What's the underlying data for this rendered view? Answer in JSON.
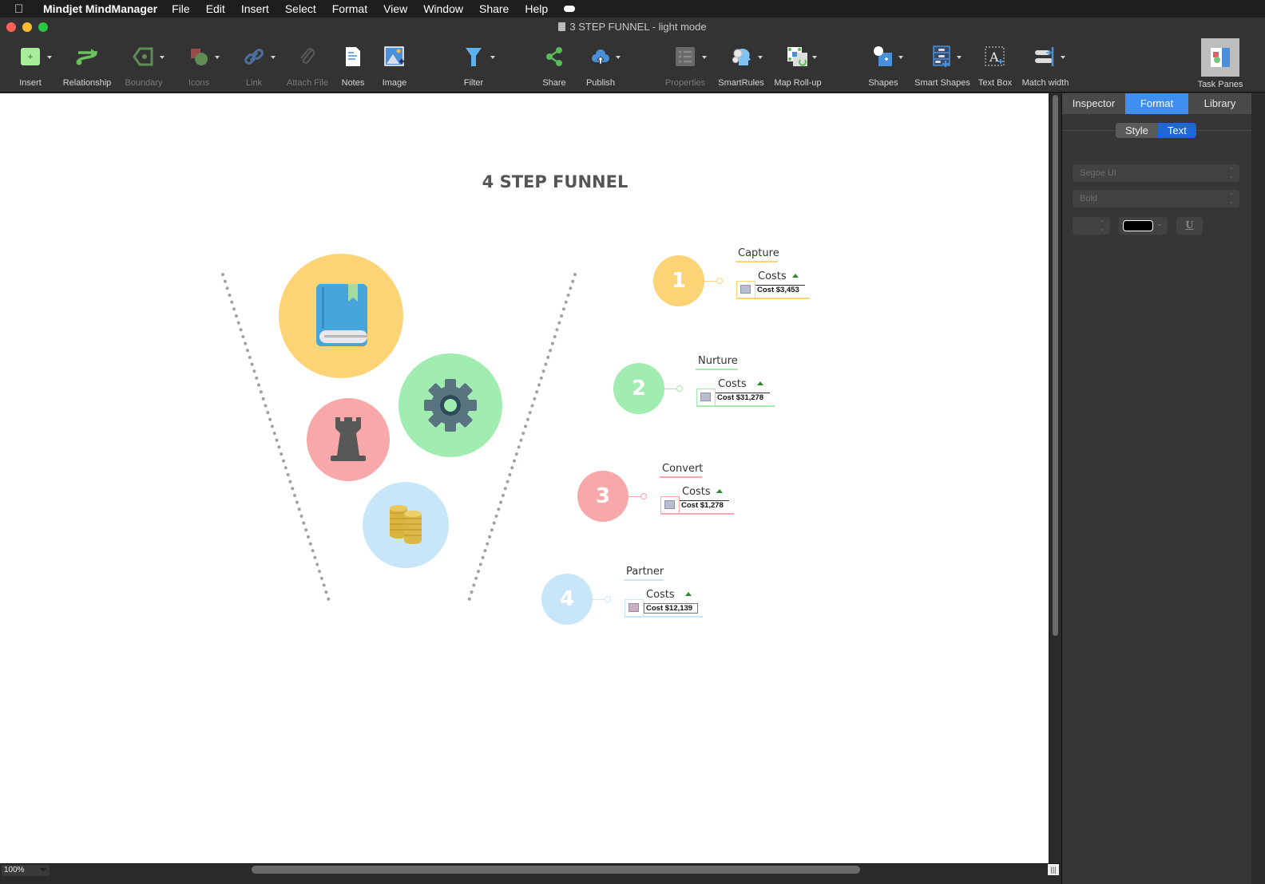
{
  "menubar": {
    "app_name": "Mindjet MindManager",
    "items": [
      "File",
      "Edit",
      "Insert",
      "Select",
      "Format",
      "View",
      "Window",
      "Share",
      "Help"
    ]
  },
  "window": {
    "title": "3 STEP FUNNEL - light mode"
  },
  "toolbar": {
    "items": [
      {
        "label": "Insert",
        "icon": "insert-topic-icon",
        "enabled": true
      },
      {
        "label": "Relationship",
        "icon": "relationship-icon",
        "enabled": true
      },
      {
        "label": "Boundary",
        "icon": "boundary-icon",
        "enabled": false
      },
      {
        "label": "Icons",
        "icon": "icons-icon",
        "enabled": false
      },
      {
        "label": "Link",
        "icon": "link-icon",
        "enabled": false
      },
      {
        "label": "Attach File",
        "icon": "paperclip-icon",
        "enabled": false
      },
      {
        "label": "Notes",
        "icon": "notes-icon",
        "enabled": true
      },
      {
        "label": "Image",
        "icon": "image-icon",
        "enabled": true
      },
      {
        "label": "Filter",
        "icon": "filter-icon",
        "enabled": true
      },
      {
        "label": "Share",
        "icon": "share-icon",
        "enabled": true
      },
      {
        "label": "Publish",
        "icon": "cloud-upload-icon",
        "enabled": true
      },
      {
        "label": "Properties",
        "icon": "properties-icon",
        "enabled": false
      },
      {
        "label": "SmartRules",
        "icon": "smartrules-icon",
        "enabled": true
      },
      {
        "label": "Map Roll-up",
        "icon": "map-rollup-icon",
        "enabled": true
      },
      {
        "label": "Shapes",
        "icon": "shapes-icon",
        "enabled": true
      },
      {
        "label": "Smart Shapes",
        "icon": "smart-shapes-icon",
        "enabled": true
      },
      {
        "label": "Text Box",
        "icon": "text-box-icon",
        "enabled": true
      },
      {
        "label": "Match width",
        "icon": "match-width-icon",
        "enabled": true
      },
      {
        "label": "Task Panes",
        "icon": "task-panes-icon",
        "enabled": true
      }
    ]
  },
  "map": {
    "title": "4 STEP FUNNEL",
    "funnel_icons": [
      "book-icon",
      "gear-icon",
      "rook-icon",
      "coins-icon"
    ],
    "steps": [
      {
        "number": "1",
        "label": "Capture",
        "costs_label": "Costs",
        "cost": "Cost $3,453",
        "color": "#fcd476"
      },
      {
        "number": "2",
        "label": "Nurture",
        "costs_label": "Costs",
        "cost": "Cost $31,278",
        "color": "#a1ecb0"
      },
      {
        "number": "3",
        "label": "Convert",
        "costs_label": "Costs",
        "cost": "Cost $1,278",
        "color": "#f8a8a8"
      },
      {
        "number": "4",
        "label": "Partner",
        "costs_label": "Costs",
        "cost": "Cost $12,139",
        "color": "#c8e6fa"
      }
    ]
  },
  "status": {
    "zoom": "100%"
  },
  "panel": {
    "tabs": [
      "Inspector",
      "Format",
      "Library"
    ],
    "active_tab": "Format",
    "subtabs": [
      "Style",
      "Text"
    ],
    "active_subtab": "Text",
    "font_family": "Segoe UI",
    "font_style": "Bold",
    "font_size": "",
    "text_color": "#000000",
    "underline_label": "U"
  }
}
